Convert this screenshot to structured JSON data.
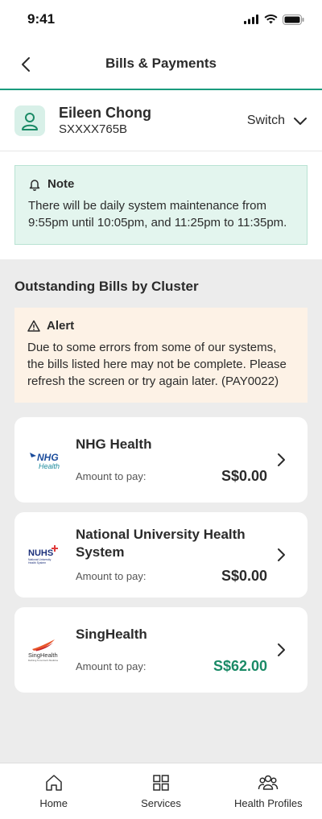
{
  "status_bar": {
    "time": "9:41",
    "icons": [
      "signal-icon",
      "wifi-icon",
      "battery-icon"
    ]
  },
  "header": {
    "title": "Bills & Payments",
    "back_icon": "chevron-left-icon"
  },
  "profile": {
    "name": "Eileen Chong",
    "id": "SXXXX765B",
    "switch_label": "Switch"
  },
  "note": {
    "title": "Note",
    "text": "There will be daily system maintenance from 9:55pm until 10:05pm, and 11:25pm to 11:35pm."
  },
  "section_title": "Outstanding Bills by Cluster",
  "alert": {
    "title": "Alert",
    "text": "Due to some errors from some of our systems, the bills listed here may not be complete. Please refresh the screen or try again later. (PAY0022)"
  },
  "bills": [
    {
      "name": "NHG Health",
      "amount_label": "Amount to pay:",
      "amount": "S$0.00",
      "logo_text": "NHG",
      "logo_sub": "Health"
    },
    {
      "name": "National University Health System",
      "amount_label": "Amount to pay:",
      "amount": "S$0.00",
      "logo_text": "NUHS",
      "logo_sub": "National University Health System"
    },
    {
      "name": "SingHealth",
      "amount_label": "Amount to pay:",
      "amount": "S$62.00",
      "logo_text": "SingHealth",
      "logo_sub": "Defining Tomorrow's Medicine"
    }
  ],
  "tabbar": [
    {
      "label": "Home",
      "icon": "home-icon"
    },
    {
      "label": "Services",
      "icon": "grid-icon"
    },
    {
      "label": "Health Profiles",
      "icon": "people-icon"
    }
  ],
  "colors": {
    "accent": "#1a9b7d",
    "note_bg": "#e3f5ee",
    "alert_bg": "#fdf2e6",
    "amount_due": "#1a8a66",
    "page_bg": "#ececec"
  }
}
